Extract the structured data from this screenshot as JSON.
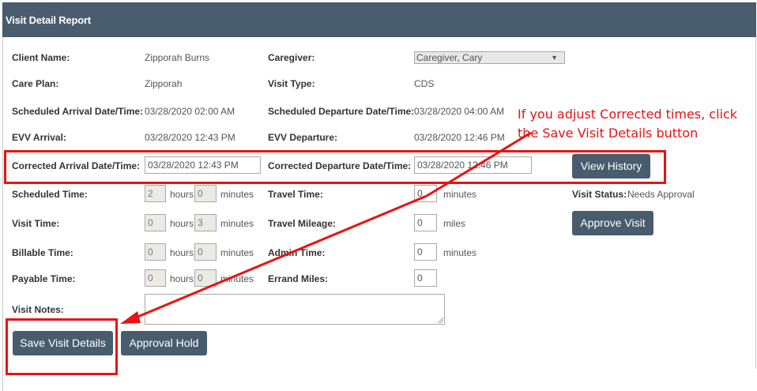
{
  "header": {
    "title": "Visit Detail Report"
  },
  "fields": {
    "client_name": {
      "label": "Client Name:",
      "value": "Zipporah Burns"
    },
    "caregiver": {
      "label": "Caregiver:",
      "value": "Caregiver, Cary"
    },
    "care_plan": {
      "label": "Care Plan:",
      "value": "Zipporah"
    },
    "visit_type": {
      "label": "Visit Type:",
      "value": "CDS"
    },
    "scheduled_arrival": {
      "label": "Scheduled Arrival Date/Time:",
      "value": "03/28/2020 02:00 AM"
    },
    "scheduled_departure": {
      "label": "Scheduled Departure Date/Time:",
      "value": "03/28/2020 04:00 AM"
    },
    "evv_arrival": {
      "label": "EVV Arrival:",
      "value": "03/28/2020 12:43 PM"
    },
    "evv_departure": {
      "label": "EVV Departure:",
      "value": "03/28/2020 12:46 PM"
    },
    "corrected_arrival": {
      "label": "Corrected Arrival Date/Time:",
      "value": "03/28/2020 12:43 PM"
    },
    "corrected_departure": {
      "label": "Corrected Departure Date/Time:",
      "value": "03/28/2020 12:46 PM"
    },
    "scheduled_time": {
      "label": "Scheduled Time:",
      "hours": "2",
      "minutes": "0"
    },
    "visit_time": {
      "label": "Visit Time:",
      "hours": "0",
      "minutes": "3"
    },
    "billable_time": {
      "label": "Billable Time:",
      "hours": "0",
      "minutes": "0"
    },
    "payable_time": {
      "label": "Payable Time:",
      "hours": "0",
      "minutes": "0"
    },
    "travel_time": {
      "label": "Travel Time:",
      "value": "0",
      "unit": "minutes"
    },
    "travel_mileage": {
      "label": "Travel Mileage:",
      "value": "0",
      "unit": "miles"
    },
    "admin_time": {
      "label": "Admin Time:",
      "value": "0",
      "unit": "minutes"
    },
    "errand_miles": {
      "label": "Errand Miles:",
      "value": "0"
    },
    "visit_notes": {
      "label": "Visit Notes:",
      "value": ""
    },
    "visit_status": {
      "label": "Visit Status:",
      "value": "Needs Approval"
    }
  },
  "units": {
    "hours": "hours",
    "minutes": "minutes"
  },
  "buttons": {
    "view_history": "View History",
    "approve_visit": "Approve Visit",
    "save_visit_details": "Save Visit Details",
    "approval_hold": "Approval Hold"
  },
  "annotation": {
    "line1": "If you adjust Corrected times, click",
    "line2": "the Save Visit Details button",
    "color": "#e81313"
  },
  "colors": {
    "header_bg": "#485c6e",
    "button_bg": "#485c6e",
    "highlight": "#e81313"
  }
}
